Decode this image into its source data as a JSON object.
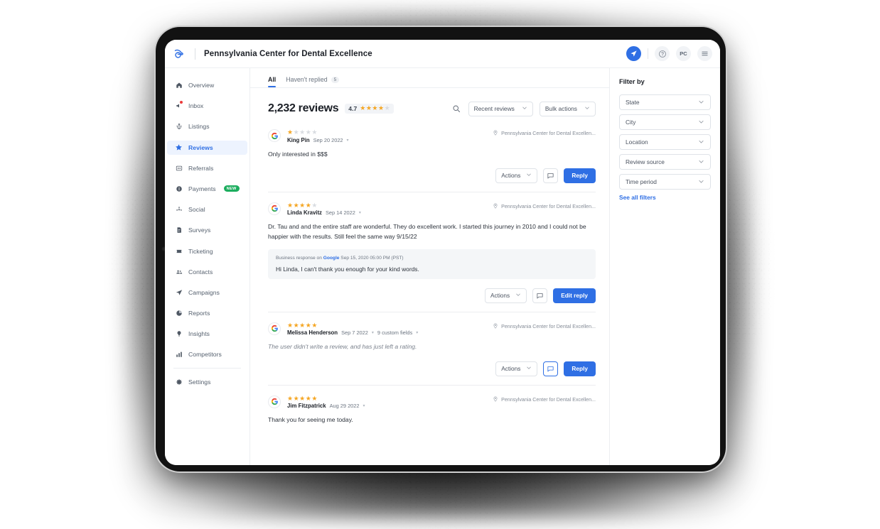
{
  "app": {
    "brand_icon": "birdeye-logo-icon",
    "title": "Pennsylvania Center for Dental Excellence",
    "header_icons": {
      "send": "send-icon",
      "help": "help-circle-icon",
      "account_initials": "PC",
      "menu": "hamburger-menu-icon"
    },
    "accent_color": "#2f6fe4",
    "star_color": "#f5a623",
    "badge_color": "#1cad5e"
  },
  "sidebar": {
    "items": [
      {
        "label": "Overview",
        "icon": "home-icon",
        "active": false
      },
      {
        "label": "Inbox",
        "icon": "megaphone-icon",
        "active": false,
        "notification": true
      },
      {
        "label": "Listings",
        "icon": "anchor-icon",
        "active": false
      },
      {
        "label": "Reviews",
        "icon": "star-icon",
        "active": true
      },
      {
        "label": "Referrals",
        "icon": "referrals-icon",
        "active": false
      },
      {
        "label": "Payments",
        "icon": "coin-icon",
        "active": false,
        "badge": "NEW"
      },
      {
        "label": "Social",
        "icon": "share-nodes-icon",
        "active": false
      },
      {
        "label": "Surveys",
        "icon": "survey-clipboard-icon",
        "active": false
      },
      {
        "label": "Ticketing",
        "icon": "ticket-icon",
        "active": false
      },
      {
        "label": "Contacts",
        "icon": "users-icon",
        "active": false
      },
      {
        "label": "Campaigns",
        "icon": "paper-plane-icon",
        "active": false
      },
      {
        "label": "Reports",
        "icon": "pie-chart-icon",
        "active": false
      },
      {
        "label": "Insights",
        "icon": "lightbulb-icon",
        "active": false
      },
      {
        "label": "Competitors",
        "icon": "bar-chart-icon",
        "active": false
      }
    ],
    "footer": {
      "label": "Settings",
      "icon": "gear-icon"
    }
  },
  "main": {
    "tabs": [
      {
        "label": "All",
        "active": true
      },
      {
        "label": "Haven't replied",
        "count": "5",
        "active": false
      }
    ],
    "summary": {
      "review_count": "2,232 reviews",
      "rating_value": "4.7",
      "stars_filled": 4,
      "stars_half": 1,
      "stars_total": 5,
      "search_icon": "search-icon",
      "sort_dropdown": "Recent reviews",
      "bulk_dropdown": "Bulk actions"
    },
    "reviews": [
      {
        "source_icon": "google-icon",
        "author": "King Pin",
        "date": "Sep 20 2022",
        "rating": 1,
        "location": "Pennsylvania Center for Dental Excellen...",
        "text": "Only interested in $$$",
        "text_muted": false,
        "custom_fields": null,
        "response": null,
        "actions_label": "Actions",
        "comment_icon": "comment-icon",
        "comment_highlight": false,
        "primary_label": "Reply"
      },
      {
        "source_icon": "google-icon",
        "author": "Linda Kravitz",
        "date": "Sep 14 2022",
        "rating": 4,
        "location": "Pennsylvania Center for Dental Excellen...",
        "text": "Dr. Tau and and the entire staff are wonderful. They do excellent work. I started this journey in 2010 and I could not be happier with the results. Still feel the same way 9/15/22",
        "text_muted": false,
        "custom_fields": null,
        "response": {
          "prefix": "Business response on",
          "source": "Google",
          "timestamp": "Sep 15, 2020 05:00 PM (PST)",
          "body": "Hi Linda, I can't thank you enough for your kind words."
        },
        "actions_label": "Actions",
        "comment_icon": "comment-icon",
        "comment_highlight": false,
        "primary_label": "Edit reply"
      },
      {
        "source_icon": "google-icon",
        "author": "Melissa Henderson",
        "date": "Sep 7 2022",
        "rating": 5,
        "location": "Pennsylvania Center for Dental Excellen...",
        "text": "The user didn't write a review, and has just left a rating.",
        "text_muted": true,
        "custom_fields": "9 custom fields",
        "response": null,
        "actions_label": "Actions",
        "comment_icon": "comment-icon",
        "comment_highlight": true,
        "primary_label": "Reply"
      },
      {
        "source_icon": "google-icon",
        "author": "Jim Fitzpatrick",
        "date": "Aug 29 2022",
        "rating": 5,
        "location": "Pennsylvania Center for Dental Excellen...",
        "text": "Thank you for seeing me today.",
        "text_muted": false,
        "custom_fields": null,
        "response": null,
        "actions_label": "Actions",
        "comment_icon": "comment-icon",
        "comment_highlight": false,
        "primary_label": "Reply"
      }
    ]
  },
  "filters": {
    "title": "Filter by",
    "dropdowns": [
      "State",
      "City",
      "Location",
      "Review source",
      "Time period"
    ],
    "see_all_label": "See all filters"
  }
}
